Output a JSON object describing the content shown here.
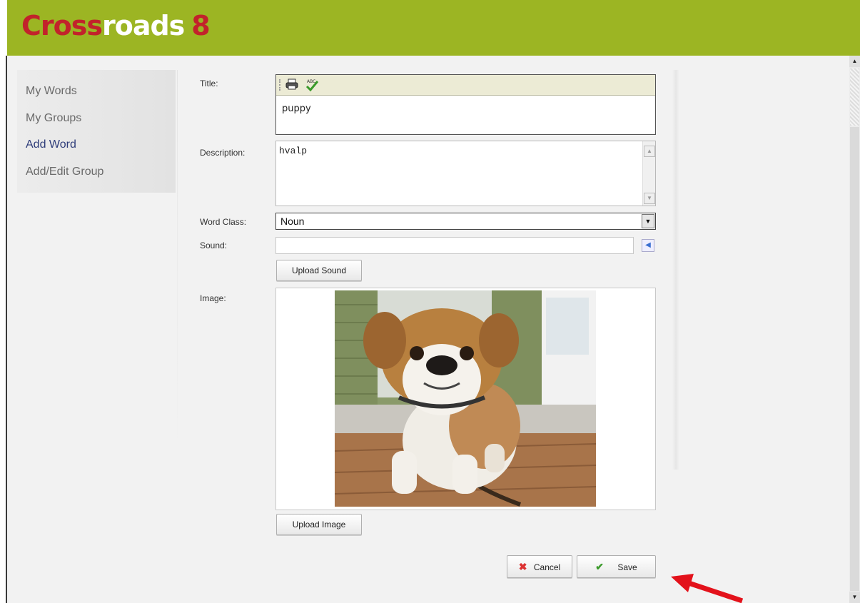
{
  "app": {
    "logo_part1": "Cross",
    "logo_part2": "roads",
    "logo_number": "8"
  },
  "sidebar": {
    "items": [
      {
        "label": "My Words"
      },
      {
        "label": "My Groups"
      },
      {
        "label": "Add Word"
      },
      {
        "label": "Add/Edit Group"
      }
    ],
    "active": "Add Word"
  },
  "form": {
    "title_label": "Title:",
    "title_value": "puppy",
    "description_label": "Description:",
    "description_value": "hvalp",
    "word_class_label": "Word Class:",
    "word_class_value": "Noun",
    "sound_label": "Sound:",
    "sound_value": "",
    "upload_sound_label": "Upload Sound",
    "image_label": "Image:",
    "upload_image_label": "Upload Image",
    "cancel_label": "Cancel",
    "save_label": "Save"
  },
  "colors": {
    "header": "#9cb523",
    "logo_red": "#c2222b",
    "active_link": "#2f3d7a",
    "annotation_arrow": "#e3121b"
  },
  "icons": [
    "print-icon",
    "spellcheck-icon",
    "speaker-icon",
    "cancel-x-icon",
    "save-check-icon"
  ]
}
